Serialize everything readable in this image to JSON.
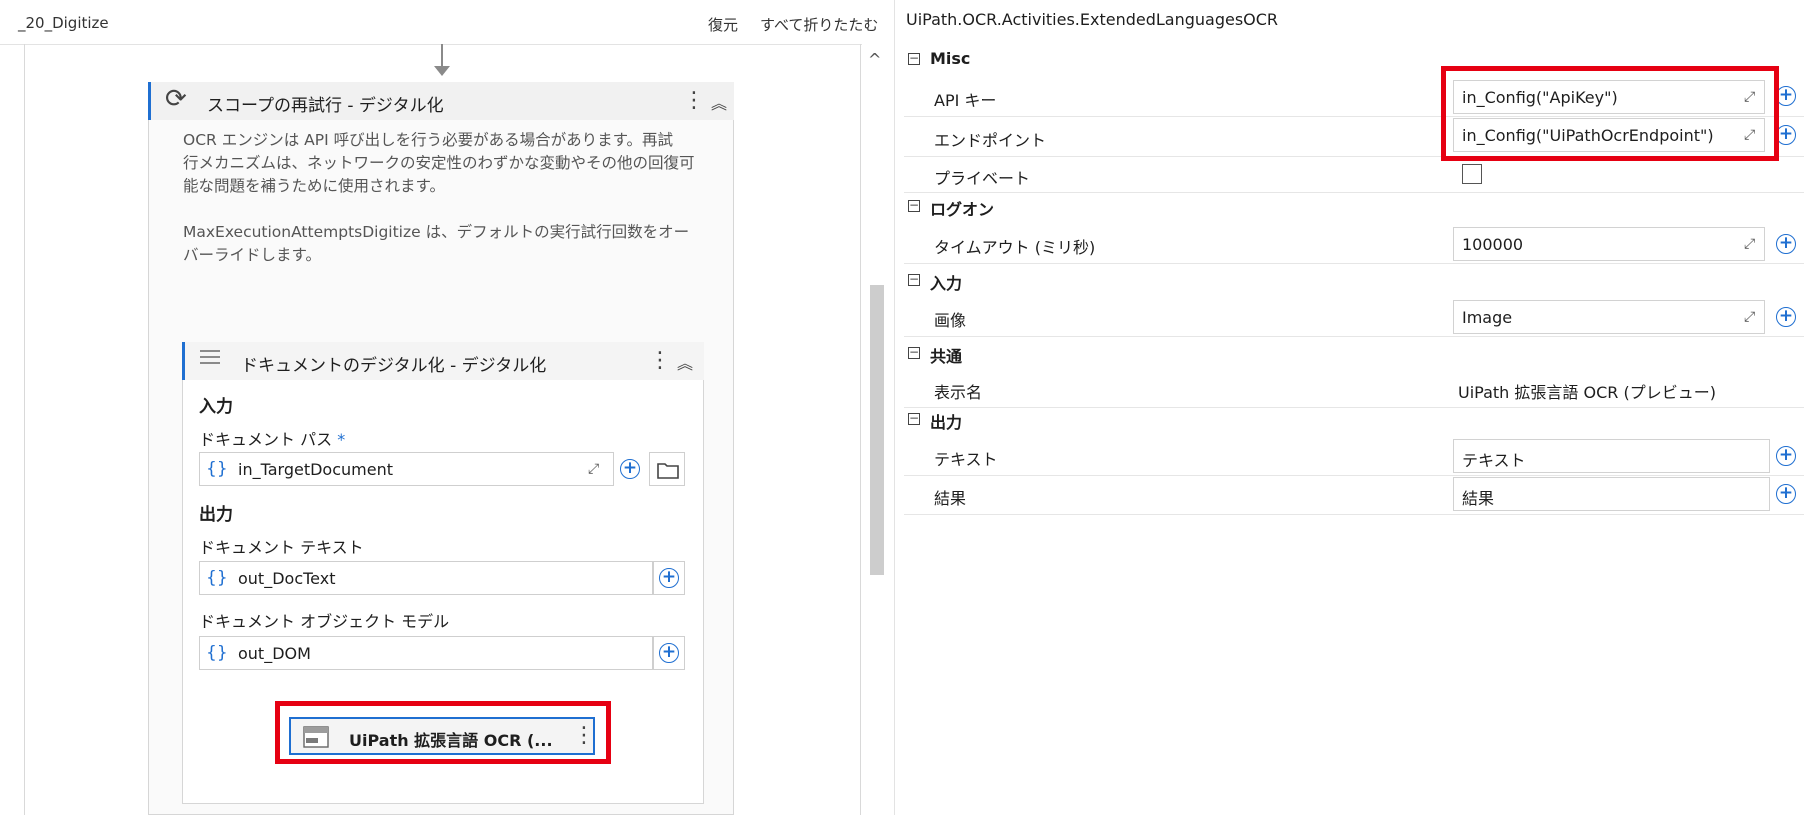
{
  "designer": {
    "breadcrumb": "_20_Digitize",
    "restore_label": "復元",
    "collapse_all_label": "すべて折りたたむ",
    "scope": {
      "title": "スコープの再試行 - デジタル化",
      "description_1": "OCR エンジンは API 呼び出しを行う必要がある場合があります。再試",
      "description_2": "行メカニズムは、ネットワークの安定性のわずかな変動やその他の回復可",
      "description_3": "能な問題を補うために使用されます。",
      "description_4": "MaxExecutionAttemptsDigitize は、デフォルトの実行試行回数をオー",
      "description_5": "バーライドします。"
    },
    "digitize": {
      "title": "ドキュメントのデジタル化 - デジタル化",
      "input_section": "入力",
      "document_path_label": "ドキュメント パス",
      "required_mark": "*",
      "document_path_value": "in_TargetDocument",
      "output_section": "出力",
      "document_text_label": "ドキュメント テキスト",
      "document_text_value": "out_DocText",
      "dom_label": "ドキュメント オブジェクト モデル",
      "dom_value": "out_DOM",
      "brace_icon": "{}"
    },
    "ocr_activity": {
      "label": "UiPath 拡張言語 OCR (..."
    }
  },
  "properties": {
    "title": "UiPath.OCR.Activities.ExtendedLanguagesOCR",
    "categories": [
      {
        "name": "Misc"
      },
      {
        "name": "ログオン"
      },
      {
        "name": "入力"
      },
      {
        "name": "共通"
      },
      {
        "name": "出力"
      }
    ],
    "misc": {
      "api_key_label": "API キー",
      "api_key_value": "in_Config(\"ApiKey\")",
      "endpoint_label": "エンドポイント",
      "endpoint_value": "in_Config(\"UiPathOcrEndpoint\")",
      "private_label": "プライベート",
      "private_checked": false
    },
    "logon": {
      "timeout_label": "タイムアウト (ミリ秒)",
      "timeout_value": "100000"
    },
    "input": {
      "image_label": "画像",
      "image_value": "Image"
    },
    "common": {
      "display_name_label": "表示名",
      "display_name_value": "UiPath 拡張言語 OCR (プレビュー)"
    },
    "output": {
      "text_label": "テキスト",
      "text_value": "テキスト",
      "result_label": "結果",
      "result_value": "結果"
    }
  },
  "icons": {
    "plus": "+",
    "expand": "⤢",
    "kebab": "⋮",
    "chevron_up": "︽",
    "refresh": "⟳",
    "collapse_toggle": "−"
  },
  "colors": {
    "accent": "#1f6fd1",
    "highlight": "#e60012"
  }
}
